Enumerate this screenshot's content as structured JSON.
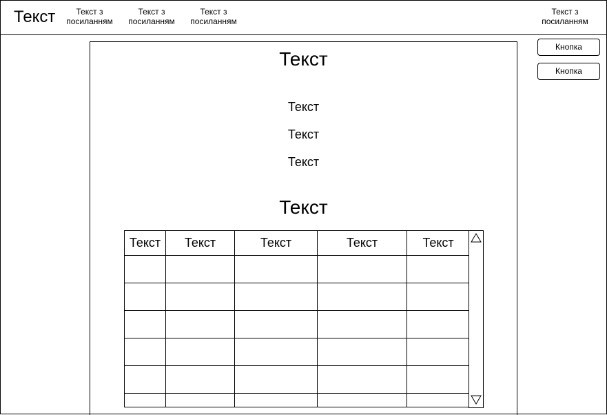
{
  "header": {
    "logo": "Текст",
    "nav": [
      "Текст з\nпосиланням",
      "Текст з\nпосиланням",
      "Текст з\nпосиланням"
    ],
    "nav_right": "Текст з\nпосиланням"
  },
  "actions": {
    "button1": "Кнопка",
    "button2": "Кнопка"
  },
  "main": {
    "title": "Текст",
    "lines": [
      "Текст",
      "Текст",
      "Текст"
    ],
    "subtitle": "Текст",
    "table": {
      "headers": [
        "Текст",
        "Текст",
        "Текст",
        "Текст",
        "Текст"
      ],
      "rows": [
        [
          "",
          "",
          "",
          "",
          ""
        ],
        [
          "",
          "",
          "",
          "",
          ""
        ],
        [
          "",
          "",
          "",
          "",
          ""
        ],
        [
          "",
          "",
          "",
          "",
          ""
        ],
        [
          "",
          "",
          "",
          "",
          ""
        ],
        [
          "",
          "",
          "",
          "",
          ""
        ]
      ]
    }
  },
  "icons": {
    "scroll_up": "triangle-up-icon",
    "scroll_down": "triangle-down-icon"
  }
}
